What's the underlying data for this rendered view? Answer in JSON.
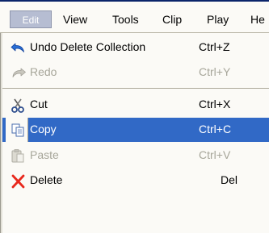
{
  "menubar": {
    "items": [
      {
        "label": "Edit"
      },
      {
        "label": "View"
      },
      {
        "label": "Tools"
      },
      {
        "label": "Clip"
      },
      {
        "label": "Play"
      },
      {
        "label": "He"
      }
    ]
  },
  "menu": {
    "items": [
      {
        "label": "Undo Delete Collection",
        "shortcut": "Ctrl+Z",
        "icon": "undo-icon",
        "enabled": true
      },
      {
        "label": "Redo",
        "shortcut": "Ctrl+Y",
        "icon": "redo-icon",
        "enabled": false
      },
      {
        "label": "Cut",
        "shortcut": "Ctrl+X",
        "icon": "scissors-icon",
        "enabled": true
      },
      {
        "label": "Copy",
        "shortcut": "Ctrl+C",
        "icon": "copy-icon",
        "enabled": true,
        "highlighted": true
      },
      {
        "label": "Paste",
        "shortcut": "Ctrl+V",
        "icon": "paste-icon",
        "enabled": false
      },
      {
        "label": "Delete",
        "shortcut": "Del",
        "icon": "delete-icon",
        "enabled": true
      }
    ]
  },
  "colors": {
    "highlight": "#3169c6",
    "disabled_text": "#a7a69a",
    "menu_bg": "#fbfaf6",
    "delete_red": "#e8281c",
    "undo_blue": "#2a6fd6"
  }
}
